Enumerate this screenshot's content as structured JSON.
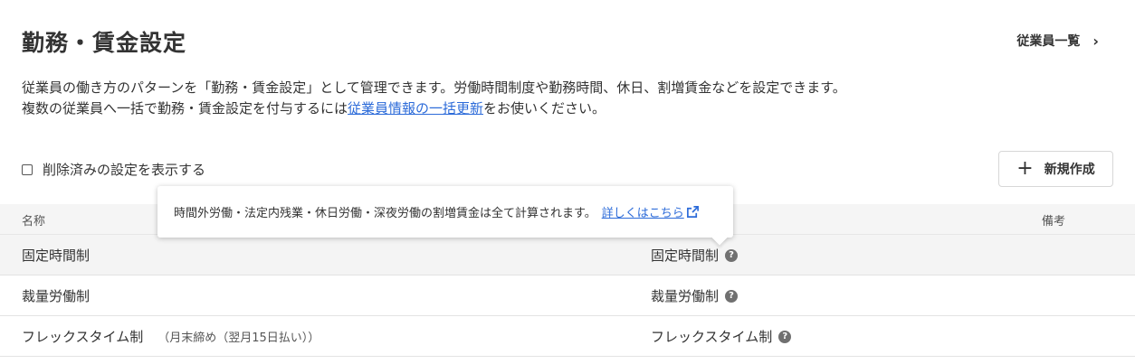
{
  "header": {
    "title": "勤務・賃金設定",
    "employee_list_link": "従業員一覧",
    "chevron": "›"
  },
  "description": {
    "line1": "従業員の働き方のパターンを「勤務・賃金設定」として管理できます。労働時間制度や勤務時間、休日、割増賃金などを設定できます。",
    "line2_before": "複数の従業員へ一括で勤務・賃金設定を付与するには",
    "line2_link": "従業員情報の一括更新",
    "line2_after": "をお使いください。"
  },
  "filter": {
    "show_deleted_label": "削除済みの設定を表示する",
    "checked": false
  },
  "new_button": {
    "icon": "+",
    "label": "新規作成"
  },
  "table": {
    "headers": {
      "name": "名称",
      "note": "備考"
    },
    "rows": [
      {
        "name": "固定時間制",
        "sub": "",
        "type": "固定時間制"
      },
      {
        "name": "裁量労働制",
        "sub": "",
        "type": "裁量労働制"
      },
      {
        "name": "フレックスタイム制",
        "sub": "（月末締め（翌月15日払い））",
        "type": "フレックスタイム制"
      }
    ]
  },
  "tooltip": {
    "text": "時間外労働・法定内残業・休日労働・深夜労働の割増賃金は全て計算されます。",
    "link": "詳しくはこちら"
  },
  "icons": {
    "help": "?",
    "external_link": "external-link-icon"
  },
  "colors": {
    "link": "#2c6bd9",
    "help_icon": "#707070"
  }
}
